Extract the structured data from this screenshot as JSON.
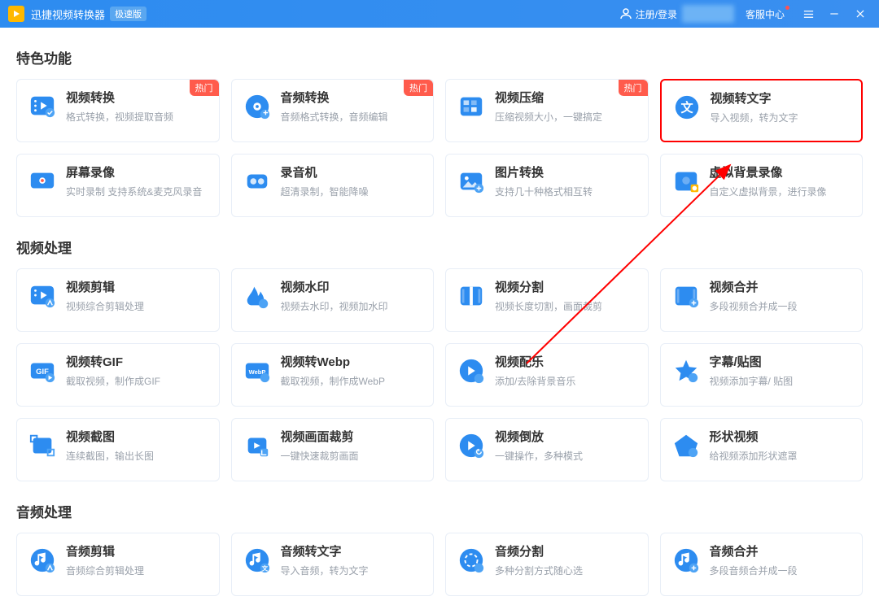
{
  "titlebar": {
    "app_name": "迅捷视频转换器",
    "edition_badge": "极速版",
    "login_label": "注册/登录",
    "support_label": "客服中心",
    "menu_icon": "≡",
    "minimize_icon": "—",
    "close_icon": "✕"
  },
  "sections": {
    "featured": "特色功能",
    "video": "视频处理",
    "audio": "音频处理"
  },
  "hot_label": "热门",
  "cards": {
    "featured": [
      {
        "title": "视频转换",
        "desc": "格式转换，视频提取音频",
        "hot": true,
        "icon": "video-convert"
      },
      {
        "title": "音频转换",
        "desc": "音频格式转换，音频编辑",
        "hot": true,
        "icon": "audio-convert"
      },
      {
        "title": "视频压缩",
        "desc": "压缩视频大小，一键搞定",
        "hot": true,
        "icon": "video-compress"
      },
      {
        "title": "视频转文字",
        "desc": "导入视频，转为文字",
        "hot": false,
        "icon": "video-to-text",
        "highlighted": true
      },
      {
        "title": "屏幕录像",
        "desc": "实时录制 支持系统&麦克风录音",
        "hot": false,
        "icon": "screen-record"
      },
      {
        "title": "录音机",
        "desc": "超清录制，智能降噪",
        "hot": false,
        "icon": "recorder"
      },
      {
        "title": "图片转换",
        "desc": "支持几十种格式相互转",
        "hot": false,
        "icon": "image-convert"
      },
      {
        "title": "虚拟背景录像",
        "desc": "自定义虚拟背景，进行录像",
        "hot": false,
        "icon": "virtual-bg"
      }
    ],
    "video": [
      {
        "title": "视频剪辑",
        "desc": "视频综合剪辑处理",
        "icon": "video-edit"
      },
      {
        "title": "视频水印",
        "desc": "视频去水印，视频加水印",
        "icon": "watermark"
      },
      {
        "title": "视频分割",
        "desc": "视频长度切割，画面裁剪",
        "icon": "video-split"
      },
      {
        "title": "视频合并",
        "desc": "多段视频合并成一段",
        "icon": "video-merge"
      },
      {
        "title": "视频转GIF",
        "desc": "截取视频，制作成GIF",
        "icon": "video-gif"
      },
      {
        "title": "视频转Webp",
        "desc": "截取视频，制作成WebP",
        "icon": "video-webp"
      },
      {
        "title": "视频配乐",
        "desc": "添加/去除背景音乐",
        "icon": "video-music"
      },
      {
        "title": "字幕/贴图",
        "desc": "视频添加字幕/ 贴图",
        "icon": "subtitle"
      },
      {
        "title": "视频截图",
        "desc": "连续截图，输出长图",
        "icon": "screenshot"
      },
      {
        "title": "视频画面裁剪",
        "desc": "一键快速裁剪画面",
        "icon": "crop"
      },
      {
        "title": "视频倒放",
        "desc": "一键操作，多种模式",
        "icon": "reverse"
      },
      {
        "title": "形状视频",
        "desc": "给视频添加形状遮罩",
        "icon": "shape"
      }
    ],
    "audio": [
      {
        "title": "音频剪辑",
        "desc": "音频综合剪辑处理",
        "icon": "audio-edit"
      },
      {
        "title": "音频转文字",
        "desc": "导入音频，转为文字",
        "icon": "audio-to-text"
      },
      {
        "title": "音频分割",
        "desc": "多种分割方式随心选",
        "icon": "audio-split"
      },
      {
        "title": "音频合并",
        "desc": "多段音频合并成一段",
        "icon": "audio-merge"
      }
    ]
  },
  "colors": {
    "primary": "#2d8cf0",
    "hot": "#ff5b4c",
    "highlight": "#ff0000"
  }
}
